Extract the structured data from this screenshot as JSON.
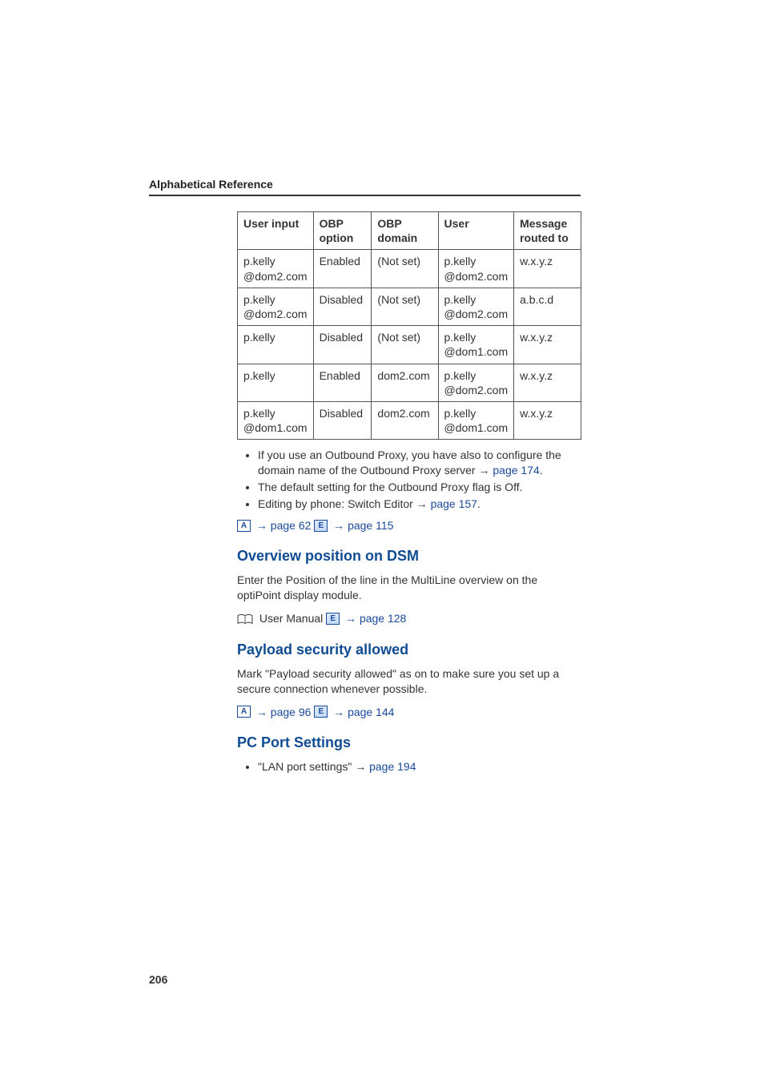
{
  "header": {
    "title": "Alphabetical Reference"
  },
  "table": {
    "columns": [
      "User input",
      "OBP option",
      "OBP domain",
      "User",
      "Message routed to"
    ],
    "rows": [
      {
        "c0": "p.kelly\n@dom2.com",
        "c1": "Enabled",
        "c2": "(Not set)",
        "c3": "p.kelly\n@dom2.com",
        "c4": "w.x.y.z"
      },
      {
        "c0": "p.kelly\n@dom2.com",
        "c1": "Disabled",
        "c2": "(Not set)",
        "c3": "p.kelly\n@dom2.com",
        "c4": "a.b.c.d"
      },
      {
        "c0": "p.kelly",
        "c1": "Disabled",
        "c2": "(Not set)",
        "c3": "p.kelly\n@dom1.com",
        "c4": "w.x.y.z"
      },
      {
        "c0": "p.kelly",
        "c1": "Enabled",
        "c2": "dom2.com",
        "c3": "p.kelly\n@dom2.com",
        "c4": "w.x.y.z"
      },
      {
        "c0": "p.kelly\n@dom1.com",
        "c1": "Disabled",
        "c2": "dom2.com",
        "c3": "p.kelly\n@dom1.com",
        "c4": "w.x.y.z"
      }
    ]
  },
  "bullets1": {
    "item0_pre": "If you use an Outbound Proxy, you have also to configure the domain name of the Outbound Proxy server ",
    "item0_link": "page 174",
    "item0_post": ".",
    "item1": "The default setting for the Outbound Proxy flag is Off.",
    "item2_pre": "Editing by phone: Switch Editor ",
    "item2_link": "page 157",
    "item2_post": "."
  },
  "refs1": {
    "a": "page 62",
    "b": "page 115"
  },
  "sec_overview": {
    "title": "Overview position on DSM",
    "text": "Enter the Position of the line in the MultiLine overview on the optiPoint display module.",
    "manual_prefix": " User Manual ",
    "manual_link": "page 128"
  },
  "sec_payload": {
    "title": "Payload security allowed",
    "text": "Mark \"Payload security allowed\" as on to make sure you set up a secure connection whenever possible.",
    "ref_a": "page 96",
    "ref_b": "page 144"
  },
  "sec_pcport": {
    "title": "PC Port Settings",
    "item_label": "\"LAN port settings\" ",
    "item_link": "page 194"
  },
  "icons": {
    "A": "A",
    "E": "E"
  },
  "arrow": "→",
  "page_number": "206"
}
